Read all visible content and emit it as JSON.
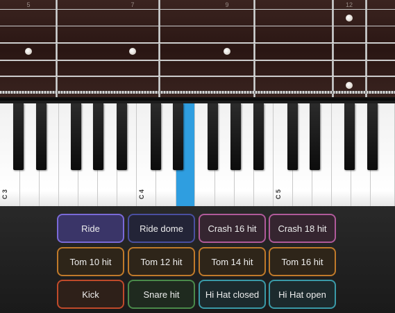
{
  "fretboard": {
    "fret_numbers": [
      "5",
      "7",
      "9",
      "12"
    ]
  },
  "keyboard": {
    "octave_labels": [
      "C 3",
      "C 4",
      "C 5"
    ],
    "highlight_color": "#2f9ee0"
  },
  "pads": [
    {
      "label": "Ride",
      "color": "#7a6ad8",
      "bg": "#3a3568"
    },
    {
      "label": "Ride dome",
      "color": "#4a4fa0",
      "bg": "#232437"
    },
    {
      "label": "Crash 16 hit",
      "color": "#b05a9a",
      "bg": "#352530"
    },
    {
      "label": "Crash 18 hit",
      "color": "#b05a9a",
      "bg": "#352530"
    },
    {
      "label": "Tom 10 hit",
      "color": "#c07a2a",
      "bg": "#2e2519"
    },
    {
      "label": "Tom 12 hit",
      "color": "#c07a2a",
      "bg": "#2e2519"
    },
    {
      "label": "Tom 14 hit",
      "color": "#c07a2a",
      "bg": "#2e2519"
    },
    {
      "label": "Tom 16 hit",
      "color": "#c07a2a",
      "bg": "#2e2519"
    },
    {
      "label": "Kick",
      "color": "#c04a2a",
      "bg": "#2e2019"
    },
    {
      "label": "Snare hit",
      "color": "#4a8a4a",
      "bg": "#1f2a1f"
    },
    {
      "label": "Hi Hat closed",
      "color": "#3a9aa8",
      "bg": "#1c2a2d"
    },
    {
      "label": "Hi Hat open",
      "color": "#3a9aa8",
      "bg": "#1c2a2d"
    }
  ]
}
